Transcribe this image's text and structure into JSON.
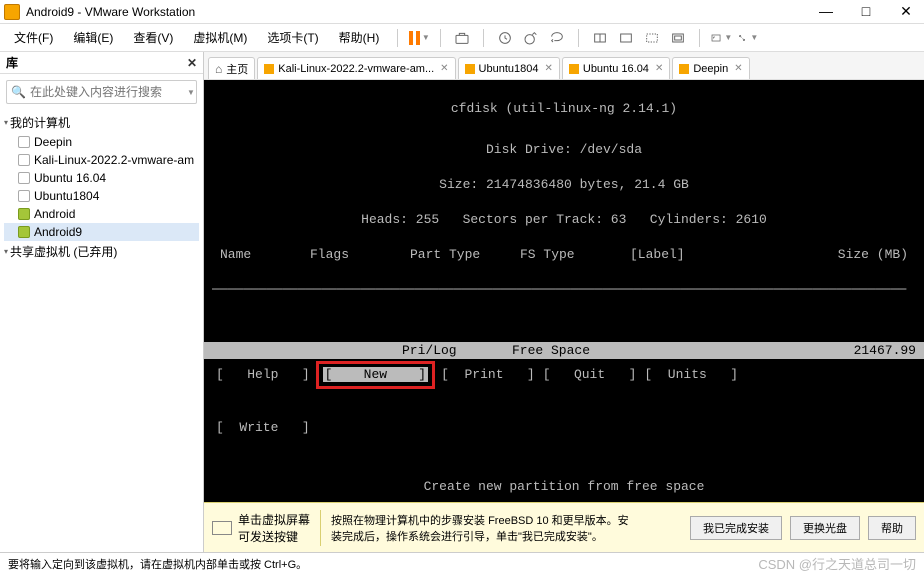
{
  "window": {
    "title": "Android9 - VMware Workstation",
    "minimize": "—",
    "maximize": "□",
    "close": "✕"
  },
  "menu": {
    "file": "文件(F)",
    "edit": "编辑(E)",
    "view": "查看(V)",
    "vm": "虚拟机(M)",
    "tabs": "选项卡(T)",
    "help": "帮助(H)"
  },
  "sidebar": {
    "title": "库",
    "close": "✕",
    "search_placeholder": "在此处键入内容进行搜索",
    "my_computer": "我的计算机",
    "items": [
      {
        "label": "Deepin"
      },
      {
        "label": "Kali-Linux-2022.2-vmware-am"
      },
      {
        "label": "Ubuntu 16.04"
      },
      {
        "label": "Ubuntu1804"
      },
      {
        "label": "Android"
      },
      {
        "label": "Android9"
      }
    ],
    "shared": "共享虚拟机 (已弃用)"
  },
  "tabs": {
    "home": "主页",
    "items": [
      {
        "label": "Kali-Linux-2022.2-vmware-am..."
      },
      {
        "label": "Ubuntu1804"
      },
      {
        "label": "Ubuntu 16.04"
      },
      {
        "label": "Deepin"
      }
    ]
  },
  "terminal": {
    "header": "cfdisk (util-linux-ng 2.14.1)",
    "drive": "Disk Drive: /dev/sda",
    "size": "Size: 21474836480 bytes, 21.4 GB",
    "geom": "Heads: 255   Sectors per Track: 63   Cylinders: 2610",
    "cols": {
      "name": "Name",
      "flags": "Flags",
      "ptype": "Part Type",
      "fstype": "FS Type",
      "label": "[Label]",
      "size": "Size (MB)"
    },
    "row": {
      "ptype": "Pri/Log",
      "fstype": "Free Space",
      "size": "21467.99"
    },
    "menu": {
      "help": "Help",
      "new": "New",
      "print": "Print",
      "quit": "Quit",
      "units": "Units",
      "write": "Write"
    },
    "hint": "Create new partition from free space"
  },
  "infobar": {
    "hint1a": "单击虚拟屏幕",
    "hint1b": "可发送按键",
    "desc": "按照在物理计算机中的步骤安装 FreeBSD 10 和更早版本。安装完成后，操作系统会进行引导，单击\"我已完成安装\"。",
    "done": "我已完成安装",
    "cd": "更换光盘",
    "help": "帮助"
  },
  "status": {
    "msg": "要将输入定向到该虚拟机，请在虚拟机内部单击或按 Ctrl+G。"
  },
  "watermark": "CSDN @行之天道总司一切"
}
